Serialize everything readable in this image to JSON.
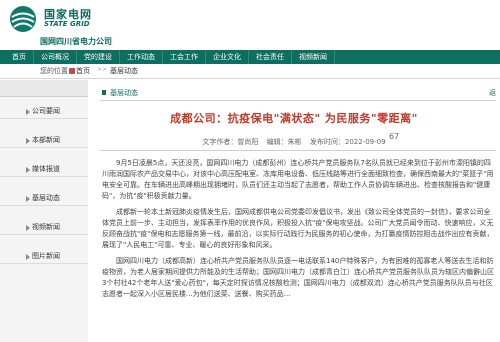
{
  "header": {
    "brand_cn": "国家电网",
    "brand_en": "STATE GRID",
    "sub_brand": "国网四川省电力公司"
  },
  "nav": {
    "items": [
      "首页",
      "公司概况",
      "党的建设",
      "工作动态",
      "工会工作",
      "企业文化",
      "社会责任",
      "视频新闻"
    ]
  },
  "breadcrumb": {
    "label": "您的位置：",
    "home": "首页",
    "current": "基层动态"
  },
  "sidebar": {
    "items": [
      {
        "label": "公司要闻"
      },
      {
        "label": "本部新闻"
      },
      {
        "label": "媒体报道"
      },
      {
        "label": "基层动态"
      },
      {
        "label": "视频新闻"
      },
      {
        "label": "图片新闻"
      }
    ]
  },
  "main": {
    "section_title": "基层动态",
    "more": "返",
    "title": "成都公司：抗疫保电\"满状态\" 为民服务\"零距离\"",
    "meta": {
      "author": "文字作者：曾尚阳",
      "editor": "编辑：朱彬",
      "publish": "发布时间：2022-09-09",
      "views": "67"
    },
    "paragraphs": [
      "9月5日凌晨5点，天还没亮，国网四川电力（成都彭州）连心桥共产党员服务队7名队员就已经来到位于彭州市濛阳镇的四川雨润国际农产品交易中心，对该中心高压配电室、冻库用电设备、低压线路等进行全面细致检查，确保西南最大的\"菜篮子\"用电安全可靠。在车辆进出高峰期出现拥堵时，队员们还主动当起了志愿者，帮助工作人员协调车辆进出、检查核酸报告和\"健康码\"，为抗\"疫\"积极贡献力量。",
      "成都新一轮本土新冠肺炎疫情发生后，国网成都供电公司党委印发倡议书，发出《致公司全体党员的一封信》，要求公司全体党员上前一步、主动担当，发挥表率作用的优良作风，积极投入抗\"疫\"保电攻坚战。公司广大党员闻令而动、快速响应，义无反顾奋战抗\"疫\"保电和志愿服务第一线，最前沿，以实际行动践行为民服务的初心使命，为打赢疫情防控阻击战作出应有贡献，展现了\"人民电工\"可靠、专业、暖心的良好形象和风采。",
      "国网四川电力（成都高新）连心桥共产党员服务队队员逐一电话联系140户特殊客户，为有困难的孤寡老人等送去生活和防疫物资，为老人居家期间提供力所能及的生活帮助；国网四川电力（成都青白江）连心桥共产党员服务队队员为辖区内偏僻山区3个村社42个老年人送\"爱心药包\"，每天定时探访情况核酸检测；国网四川电力（成都双流）连心桥共产党员服务队队员与社区志愿者一起深入小区居民楼...为他们送菜、送餐、购买药品..."
    ]
  }
}
